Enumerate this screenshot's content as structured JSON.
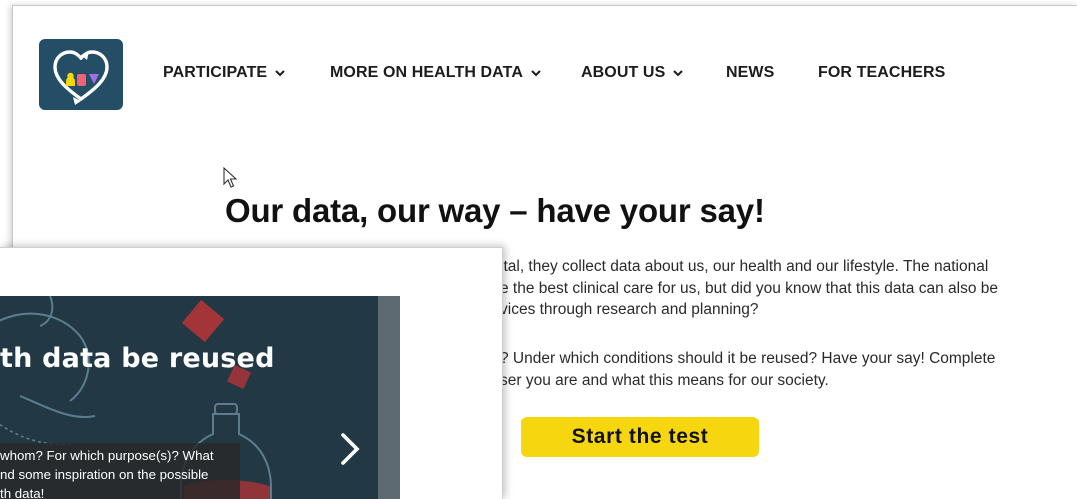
{
  "nav": {
    "items": [
      {
        "label": "PARTICIPATE",
        "dropdown": true
      },
      {
        "label": "MORE ON HEALTH DATA",
        "dropdown": true
      },
      {
        "label": "ABOUT US",
        "dropdown": true
      },
      {
        "label": "NEWS",
        "dropdown": false
      },
      {
        "label": "FOR TEACHERS",
        "dropdown": false
      }
    ]
  },
  "hero": {
    "headline": "Our data, our way – have your say!",
    "para1": [
      "ital, they collect data about us, our health and our lifestyle. The national",
      "e the best clinical care for us, but did you know that this data can also be",
      "vices through research and planning?"
    ],
    "para2": [
      "? Under which conditions should it be reused? Have your say! Complete",
      "ser you are and what this means for our society."
    ],
    "cta_label": "Start the test"
  },
  "card": {
    "title": "th data be reused",
    "desc_lines": [
      " whom? For which purpose(s)? What",
      "nd some inspiration on the possible",
      "th data!"
    ]
  },
  "colors": {
    "logo_bg": "#244e66",
    "cta_bg": "#f6d60e",
    "card_bg": "#223945",
    "accent_red": "#c8343a"
  },
  "icons": {
    "logo": "heart-recycle-logo-icon",
    "chevron": "chevron-down-icon",
    "arrow": "chevron-right-icon",
    "cursor": "mouse-pointer-icon"
  }
}
